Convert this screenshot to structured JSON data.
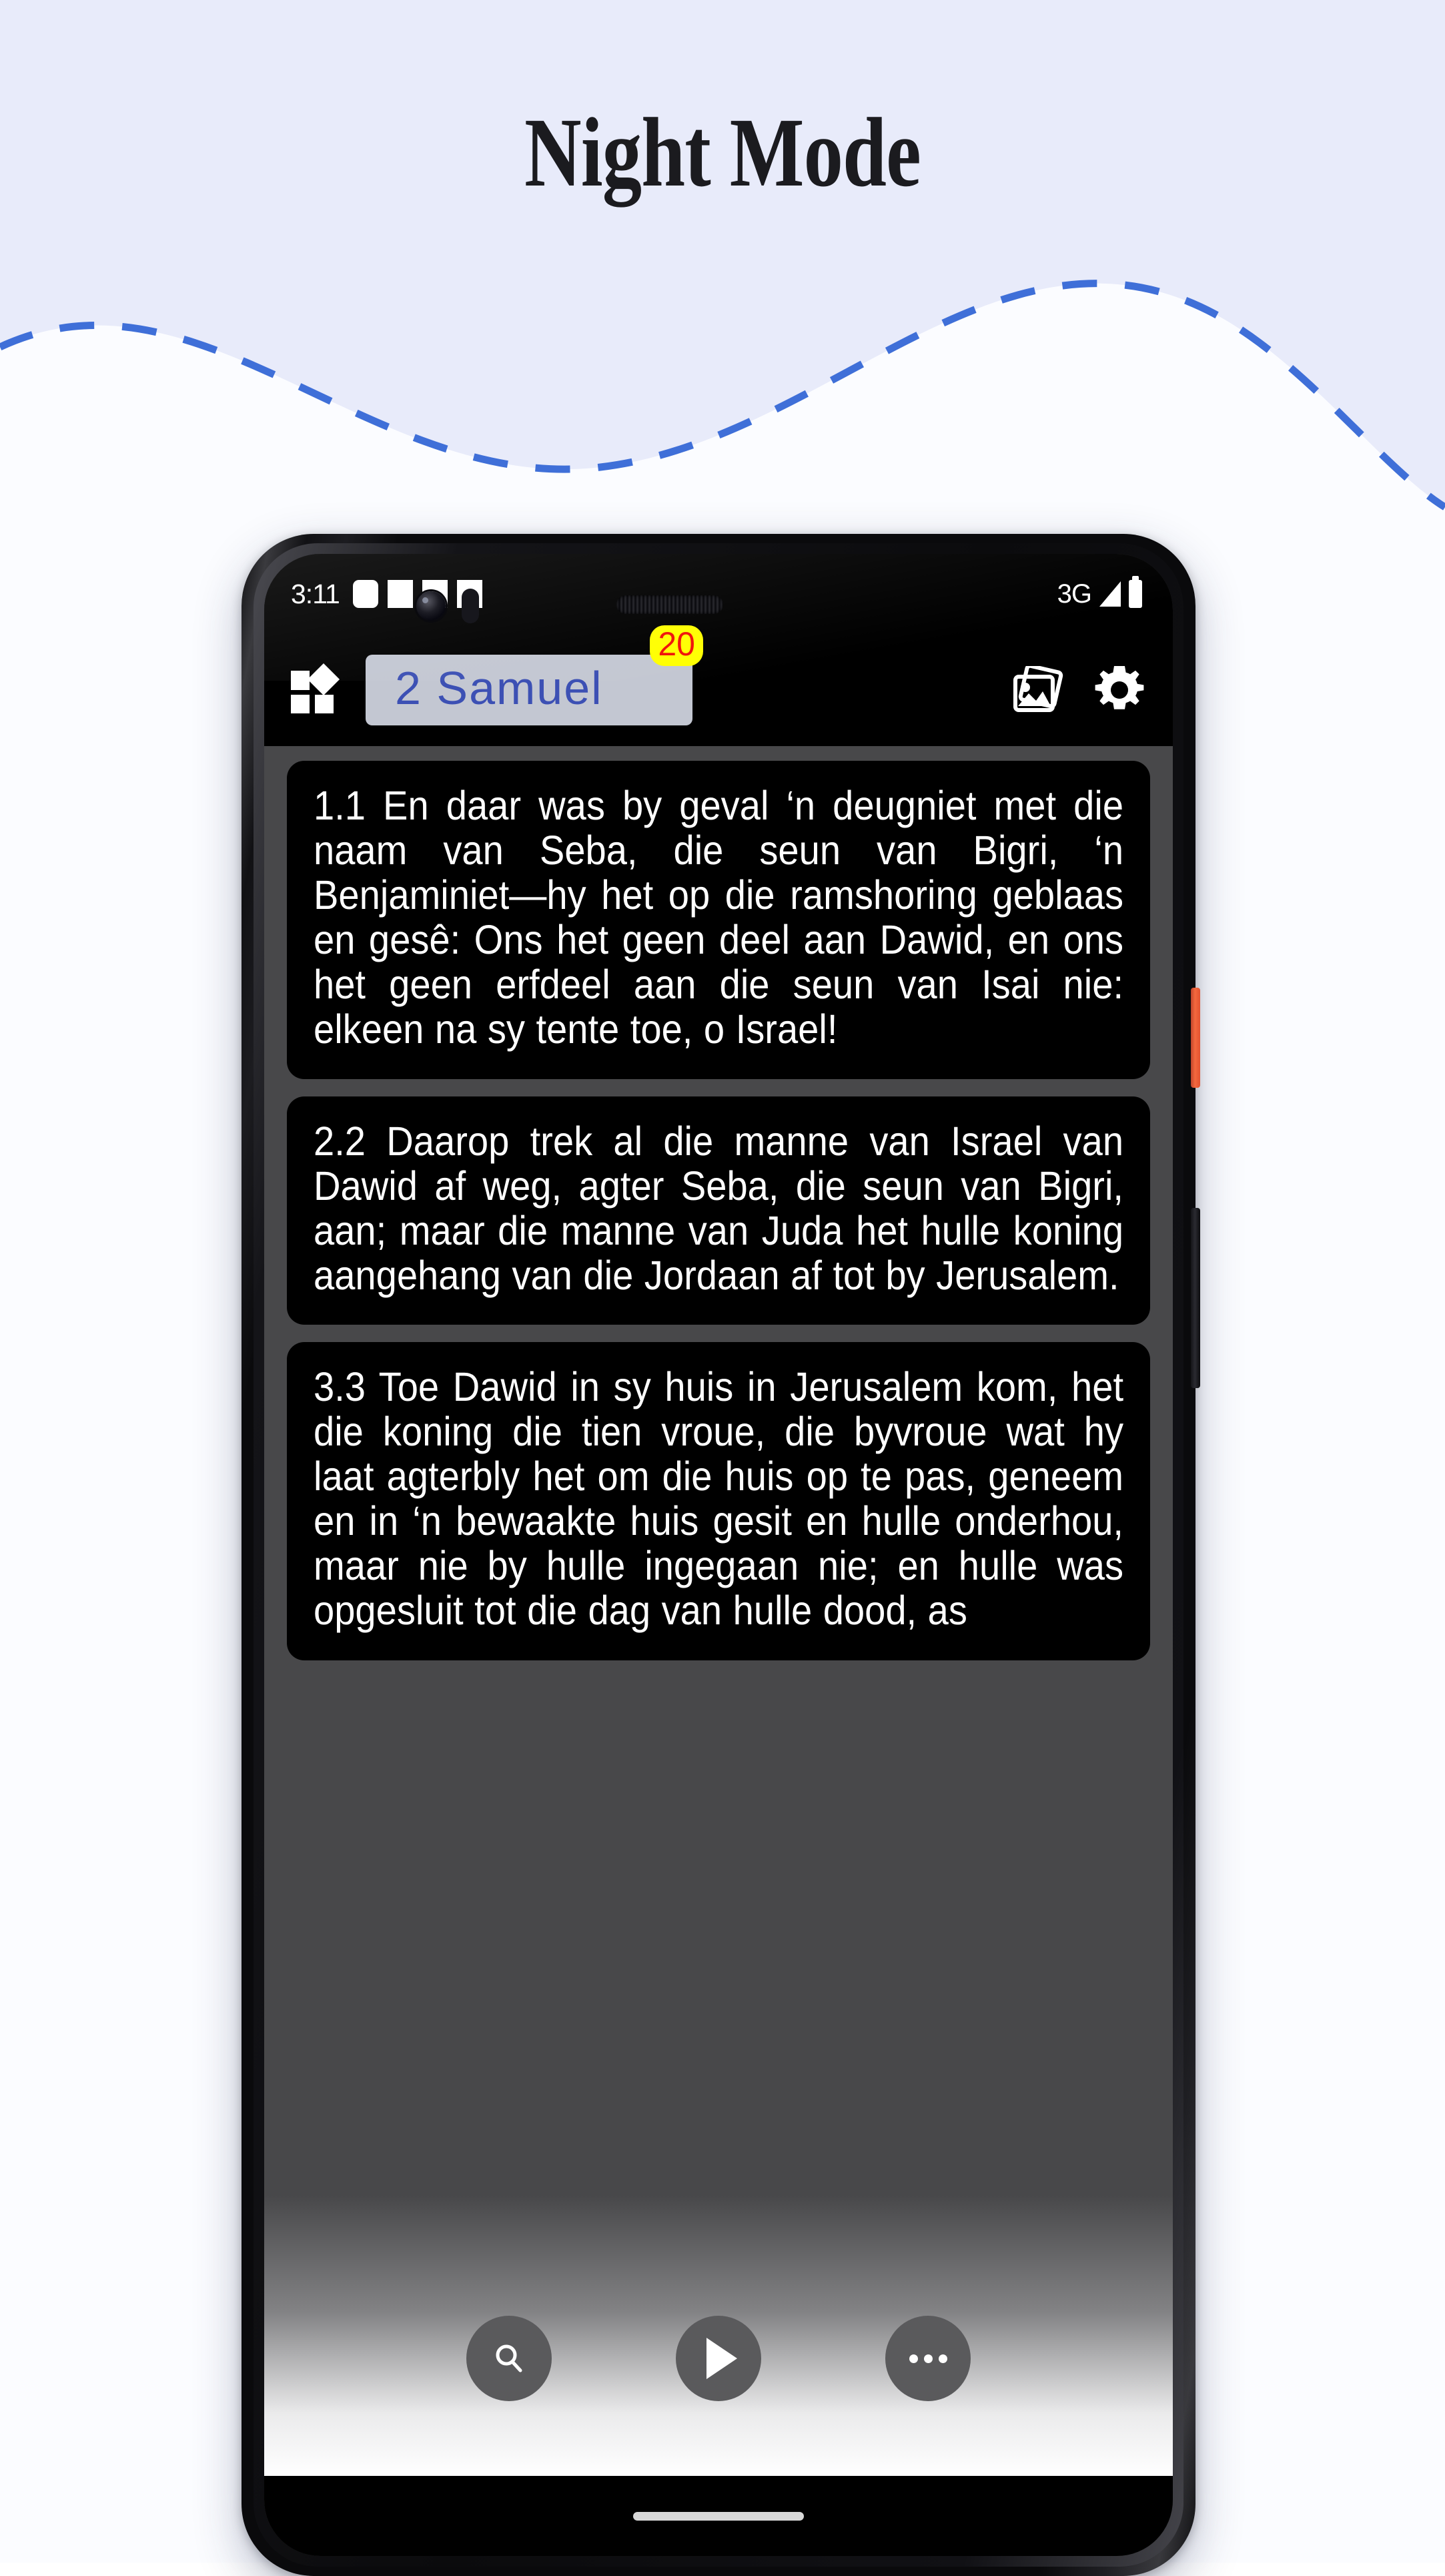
{
  "page": {
    "title": "Night Mode",
    "background_color": "#e8ebfa",
    "accent_color": "#3c50b4"
  },
  "phone": {
    "statusbar": {
      "time": "3:11",
      "network": "3G",
      "notification_blocks": 4,
      "signal_icon": "signal-triangle-icon",
      "battery_icon": "battery-full-icon"
    },
    "appbar": {
      "menu_icon": "grid-dashboard-icon",
      "book_title": "2 Samuel",
      "badge_count": "20",
      "badge_bg": "#ffff00",
      "badge_fg": "#f01008",
      "chip_bg": "#c3c7d2",
      "chip_fg": "#3c50b4",
      "gallery_icon": "images-stack-icon",
      "settings_icon": "gear-icon"
    },
    "verses": [
      {
        "ref": "1.1",
        "text": "1.1 En daar was by geval ‘n deugniet met die naam van Seba, die seun van Bigri, ‘n Benjaminiet—hy het op die ramshoring geblaas en gesê: Ons het geen deel aan Dawid, en ons het geen erfdeel aan die seun van Isai nie: elkeen na sy tente toe, o Israel!"
      },
      {
        "ref": "2.2",
        "text": "2.2 Daarop trek al die manne van Israel van Dawid af weg, agter Seba, die seun van Bigri, aan; maar die manne van Juda het hulle koning aangehang van die Jordaan af tot by Jerusalem."
      },
      {
        "ref": "3.3",
        "text": "3.3 Toe Dawid in sy huis in Jerusalem kom, het die koning die tien vroue, die byvroue wat hy laat agterbly het om die huis op te pas, geneem en in ‘n bewaakte huis gesit en hulle onderhou, maar nie by hulle ingegaan nie; en hulle was opgesluit tot die dag van hulle dood, as"
      }
    ],
    "fabs": [
      {
        "name": "search",
        "icon": "search-icon"
      },
      {
        "name": "play",
        "icon": "play-icon"
      },
      {
        "name": "more",
        "icon": "more-horizontal-icon"
      }
    ],
    "screen_bg": "#48484a",
    "card_bg": "#000000",
    "text_color": "#ffffff"
  }
}
